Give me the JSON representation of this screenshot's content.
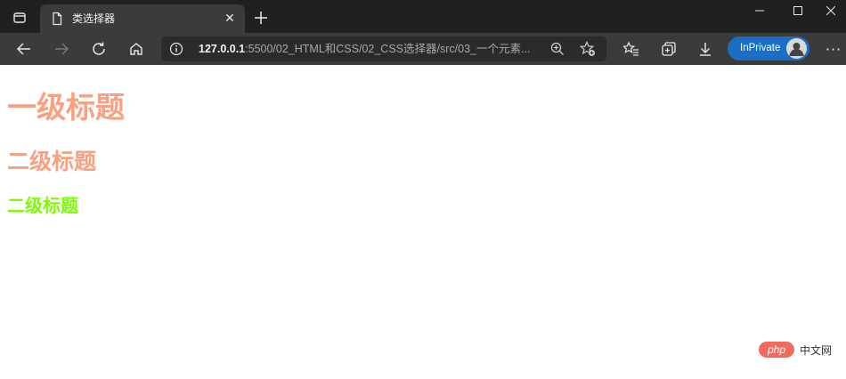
{
  "browser": {
    "tab": {
      "title": "类选择器",
      "icon": "page-icon"
    },
    "window_controls": {
      "minimize": "–",
      "maximize": "☐",
      "close": "✕"
    },
    "address": {
      "host": "127.0.0.1",
      "rest": ":5500/02_HTML和CSS/02_CSS选择器/src/03_一个元素..."
    },
    "inprivate_label": "InPrivate",
    "more_label": "···"
  },
  "page": {
    "h1": {
      "text": "一级标题",
      "color": "#f9a080"
    },
    "h2_first": {
      "text": "二级标题",
      "color": "#f9a080"
    },
    "h2_second": {
      "text": "二级标题",
      "color": "#7cfc00"
    }
  },
  "watermark": {
    "logo": "php",
    "text": "中文网"
  },
  "colors": {
    "titlebar": "#202020",
    "toolbar": "#3b3b3b",
    "accent": "#1a6fc4"
  }
}
